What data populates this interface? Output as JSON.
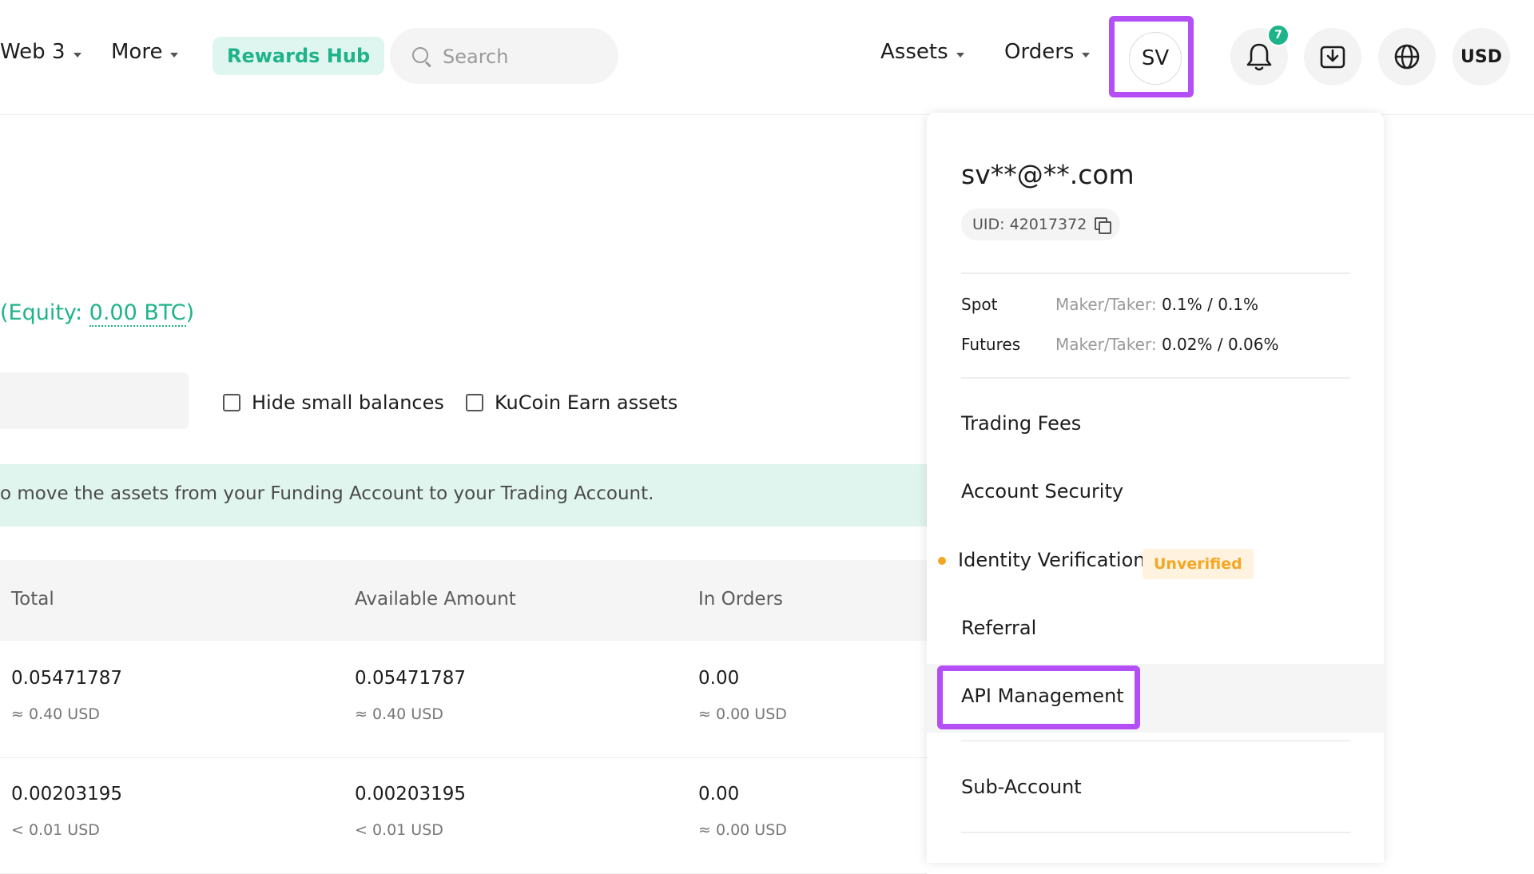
{
  "header": {
    "nav": [
      {
        "label": "Web 3"
      },
      {
        "label": "More"
      }
    ],
    "rewards_label": "Rewards Hub",
    "search_placeholder": "Search",
    "assets_label": "Assets",
    "orders_label": "Orders",
    "avatar_initials": "SV",
    "notification_count": "7",
    "currency": "USD"
  },
  "main": {
    "equity_prefix": "(Equity: ",
    "equity_value": "0.00 BTC",
    "equity_suffix": ")",
    "hide_small_label": "Hide small balances",
    "earn_label": "KuCoin Earn assets",
    "notice": "o move the assets from your Funding Account to your Trading Account.",
    "columns": [
      "Total",
      "Available Amount",
      "In Orders"
    ],
    "rows": [
      {
        "total": "0.05471787",
        "total_usd": "≈ 0.40 USD",
        "available": "0.05471787",
        "available_usd": "≈ 0.40 USD",
        "in_orders": "0.00",
        "in_orders_usd": "≈ 0.00 USD"
      },
      {
        "total": "0.00203195",
        "total_usd": "< 0.01 USD",
        "available": "0.00203195",
        "available_usd": "< 0.01 USD",
        "in_orders": "0.00",
        "in_orders_usd": "≈ 0.00 USD"
      }
    ]
  },
  "dropdown": {
    "email": "sv**@**.com",
    "uid": "UID: 42017372",
    "fees": [
      {
        "name": "Spot",
        "label": "Maker/Taker: ",
        "value": "0.1% / 0.1%"
      },
      {
        "name": "Futures",
        "label": "Maker/Taker: ",
        "value": "0.02% / 0.06%"
      }
    ],
    "menu": {
      "trading_fees": "Trading Fees",
      "account_security": "Account Security",
      "identity_verification": "Identity Verification",
      "unverified_badge": "Unverified",
      "referral": "Referral",
      "api_management": "API Management",
      "sub_account": "Sub-Account"
    }
  },
  "colors": {
    "accent_green": "#1fb38a",
    "highlight_purple": "#b44ef5",
    "warning_orange": "#f5a623"
  }
}
